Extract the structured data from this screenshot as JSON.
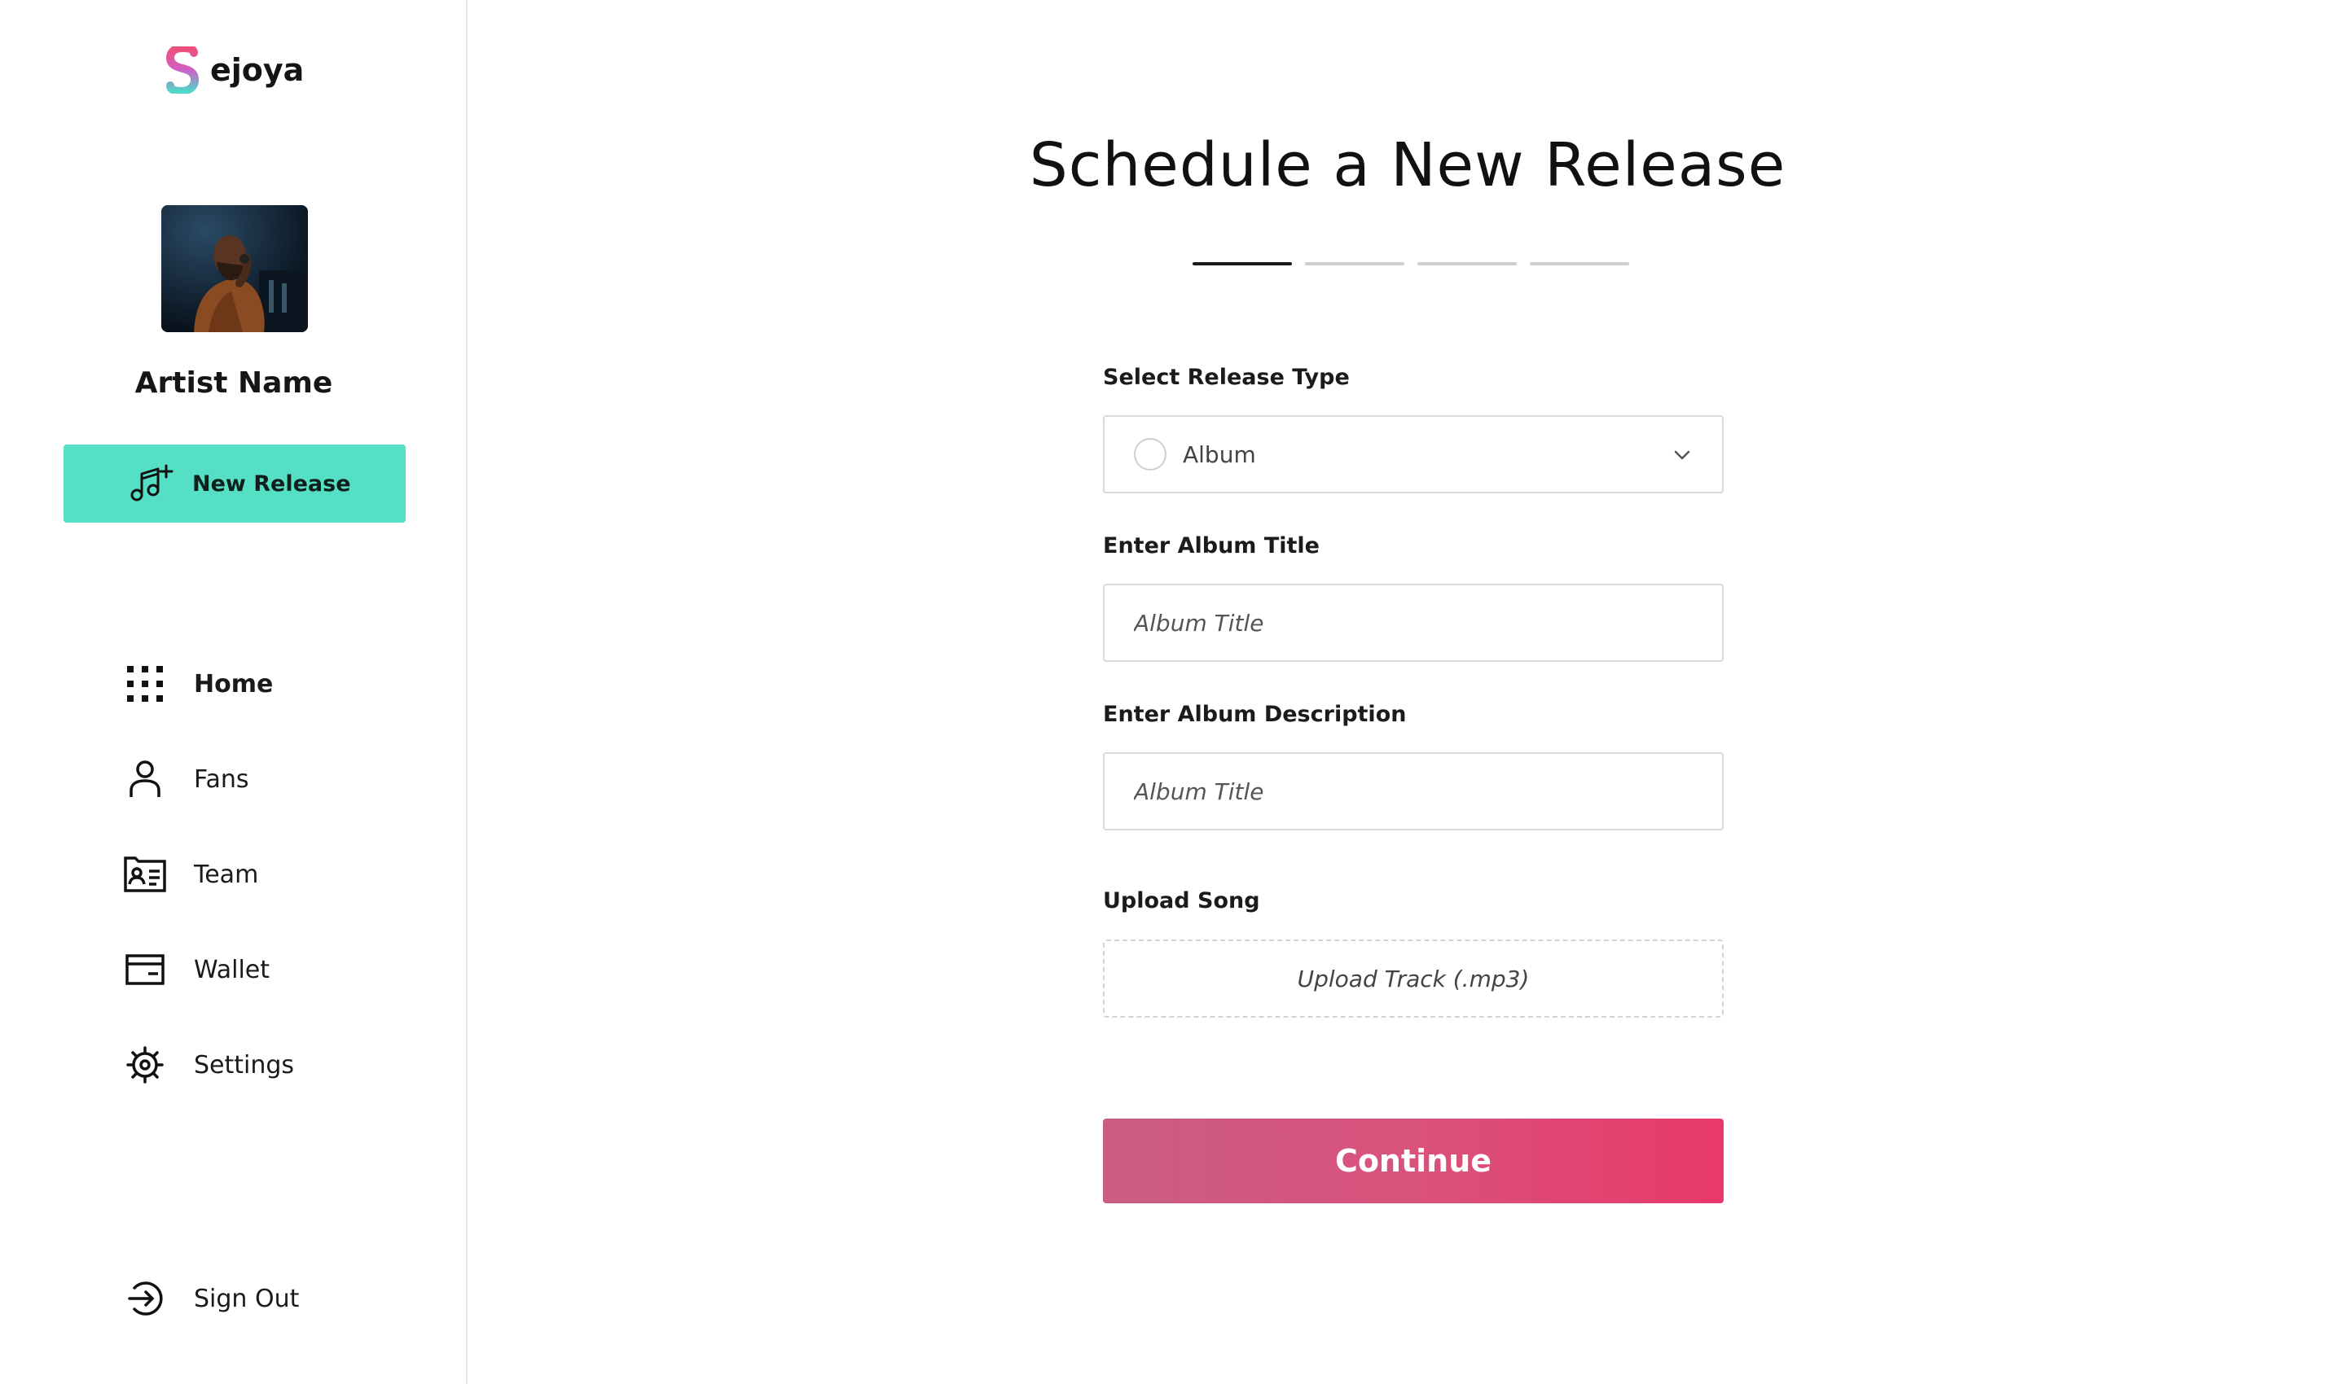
{
  "app": {
    "logo_text": "ejoya"
  },
  "colors": {
    "accent": "#55dfc5",
    "cta_start": "#cb5d85",
    "cta_end": "#e8396a",
    "text": "#111111"
  },
  "sidebar": {
    "artist_name": "Artist Name",
    "new_release_label": "New Release",
    "new_release_icon": "music-note-plus-icon",
    "items": [
      {
        "label": "Home",
        "icon": "grid-icon",
        "active": true
      },
      {
        "label": "Fans",
        "icon": "person-icon",
        "active": false
      },
      {
        "label": "Team",
        "icon": "id-card-icon",
        "active": false
      },
      {
        "label": "Wallet",
        "icon": "wallet-icon",
        "active": false
      },
      {
        "label": "Settings",
        "icon": "gear-icon",
        "active": false
      }
    ],
    "sign_out_label": "Sign Out",
    "sign_out_icon": "sign-out-icon"
  },
  "main": {
    "title": "Schedule a New Release",
    "steps": {
      "total": 4,
      "current": 1
    },
    "release_type": {
      "label": "Select Release Type",
      "value": "Album"
    },
    "album_title": {
      "label": "Enter Album Title",
      "placeholder": "Album Title",
      "value": ""
    },
    "album_description": {
      "label": "Enter Album Description",
      "placeholder": "Album Title",
      "value": ""
    },
    "upload": {
      "label": "Upload Song",
      "text": "Upload Track (.mp3)"
    },
    "continue_label": "Continue"
  }
}
